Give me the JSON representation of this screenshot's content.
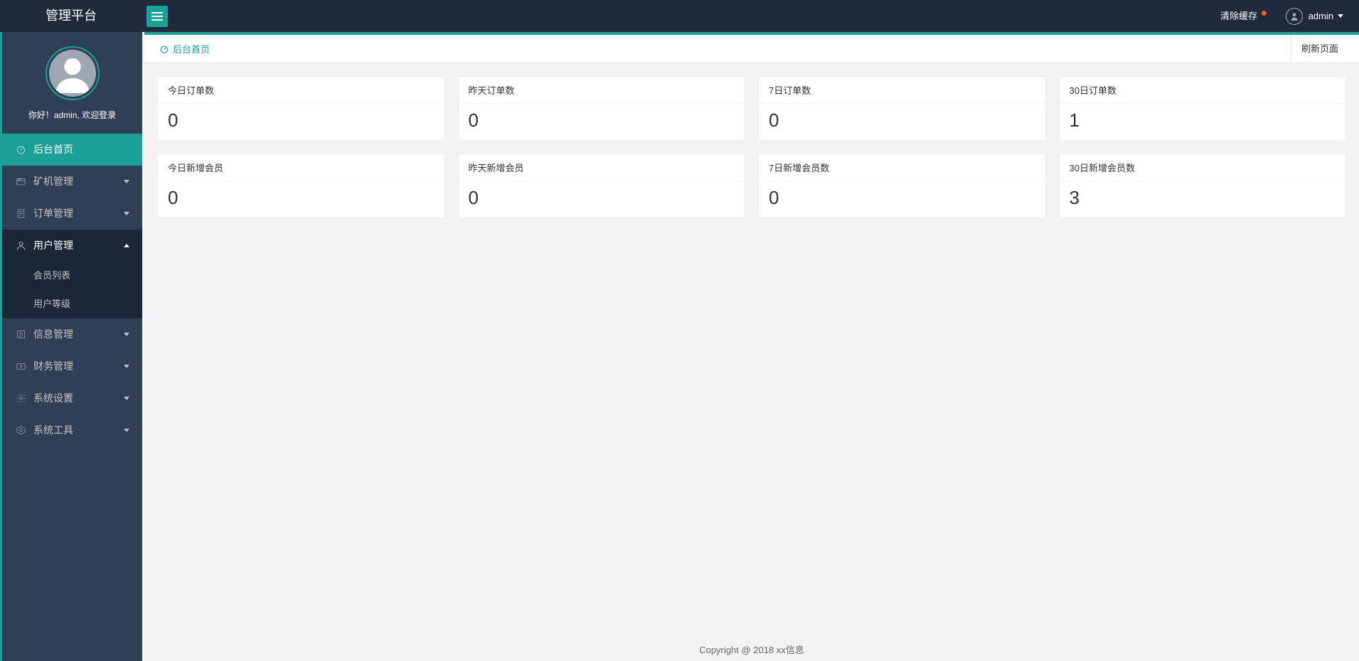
{
  "app": {
    "title": "管理平台"
  },
  "header": {
    "clear_cache_label": "清除缓存",
    "username": "admin"
  },
  "sidebar": {
    "welcome_text": "你好！admin, 欢迎登录",
    "items": [
      {
        "label": "后台首页",
        "icon": "dashboard",
        "has_children": false,
        "active": true
      },
      {
        "label": "矿机管理",
        "icon": "miner",
        "has_children": true
      },
      {
        "label": "订单管理",
        "icon": "order",
        "has_children": true
      },
      {
        "label": "用户管理",
        "icon": "user",
        "has_children": true,
        "expanded": true,
        "children": [
          {
            "label": "会员列表"
          },
          {
            "label": "用户等级"
          }
        ]
      },
      {
        "label": "信息管理",
        "icon": "info",
        "has_children": true
      },
      {
        "label": "财务管理",
        "icon": "finance",
        "has_children": true
      },
      {
        "label": "系统设置",
        "icon": "settings",
        "has_children": true
      },
      {
        "label": "系统工具",
        "icon": "tools",
        "has_children": true
      }
    ]
  },
  "tabs": {
    "home_label": "后台首页",
    "refresh_label": "刷新页面"
  },
  "stats": {
    "row1": [
      {
        "label": "今日订单数",
        "value": "0"
      },
      {
        "label": "昨天订单数",
        "value": "0"
      },
      {
        "label": "7日订单数",
        "value": "0"
      },
      {
        "label": "30日订单数",
        "value": "1"
      }
    ],
    "row2": [
      {
        "label": "今日新增会员",
        "value": "0"
      },
      {
        "label": "昨天新增会员",
        "value": "0"
      },
      {
        "label": "7日新增会员数",
        "value": "0"
      },
      {
        "label": "30日新增会员数",
        "value": "3"
      }
    ]
  },
  "footer": {
    "text": "Copyright @ 2018 xx信息"
  }
}
